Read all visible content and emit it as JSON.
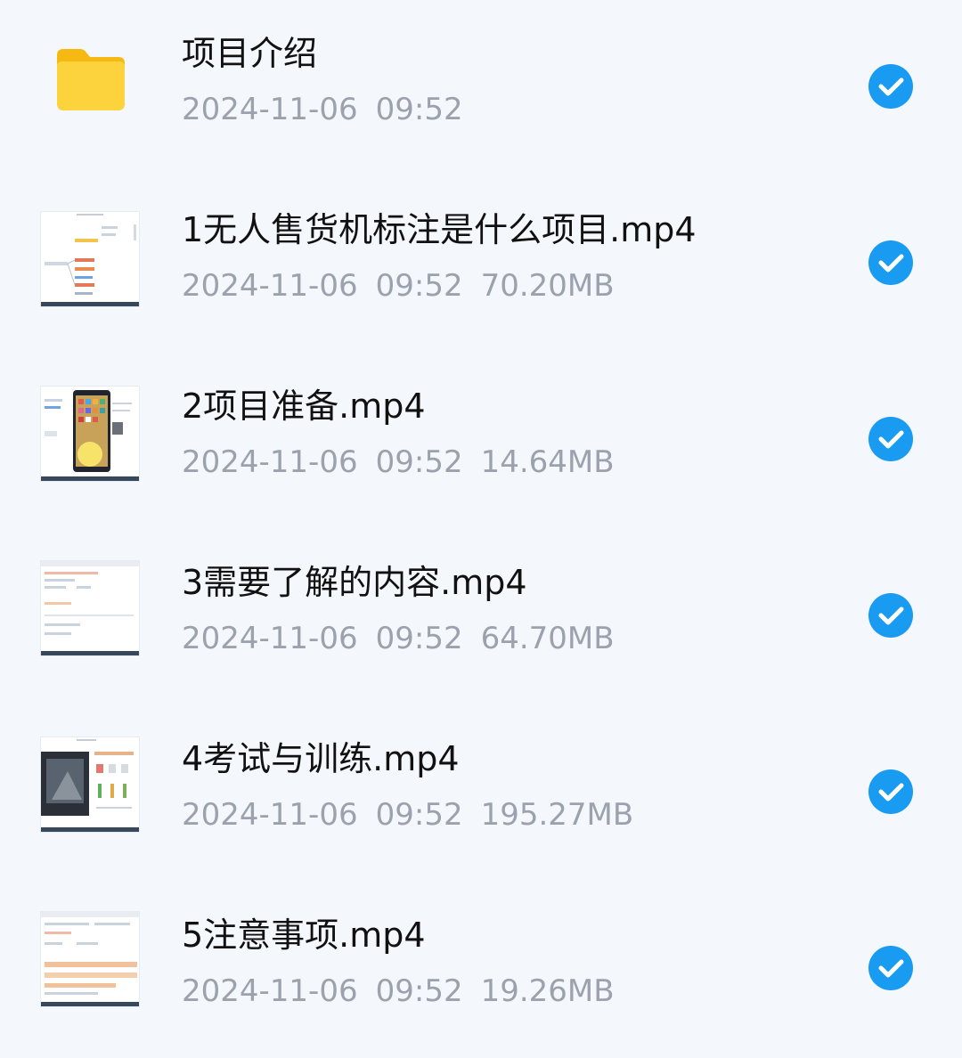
{
  "files": [
    {
      "name": "项目介绍",
      "date": "2024-11-06",
      "time": "09:52",
      "size": "",
      "type": "folder",
      "icon": "folder-icon",
      "selected": true
    },
    {
      "name": "1无人售货机标注是什么项目.mp4",
      "date": "2024-11-06",
      "time": "09:52",
      "size": "70.20MB",
      "type": "video",
      "icon": "video-thumbnail",
      "selected": true
    },
    {
      "name": "2项目准备.mp4",
      "date": "2024-11-06",
      "time": "09:52",
      "size": "14.64MB",
      "type": "video",
      "icon": "video-thumbnail",
      "selected": true
    },
    {
      "name": "3需要了解的内容.mp4",
      "date": "2024-11-06",
      "time": "09:52",
      "size": "64.70MB",
      "type": "video",
      "icon": "video-thumbnail",
      "selected": true
    },
    {
      "name": "4考试与训练.mp4",
      "date": "2024-11-06",
      "time": "09:52",
      "size": "195.27MB",
      "type": "video",
      "icon": "video-thumbnail",
      "selected": true
    },
    {
      "name": "5注意事项.mp4",
      "date": "2024-11-06",
      "time": "09:52",
      "size": "19.26MB",
      "type": "video",
      "icon": "video-thumbnail",
      "selected": true
    }
  ],
  "colors": {
    "background": "#f4f8fd",
    "check": "#1a9bf2",
    "folder": "#fcd33c",
    "meta_text": "#9ba2ad"
  }
}
